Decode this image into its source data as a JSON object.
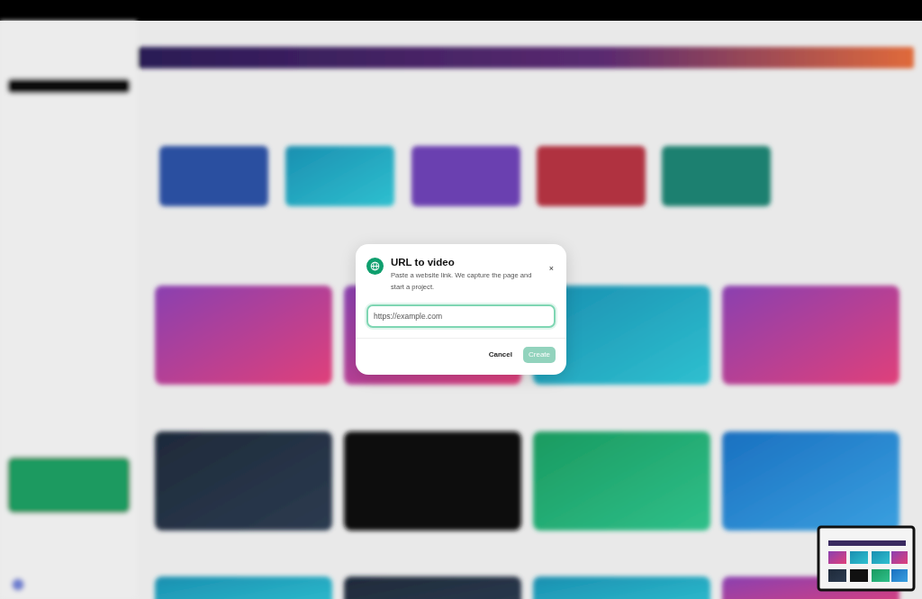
{
  "dialog": {
    "title": "URL to video",
    "description": "Paste a website link. We capture the page and start a project.",
    "close": "×",
    "input": {
      "placeholder": "https://example.com",
      "focused": true
    },
    "buttons": [
      {
        "label": "Cancel",
        "kind": "secondary",
        "disabled": false
      },
      {
        "label": "Create",
        "kind": "primary",
        "disabled": true
      }
    ]
  }
}
